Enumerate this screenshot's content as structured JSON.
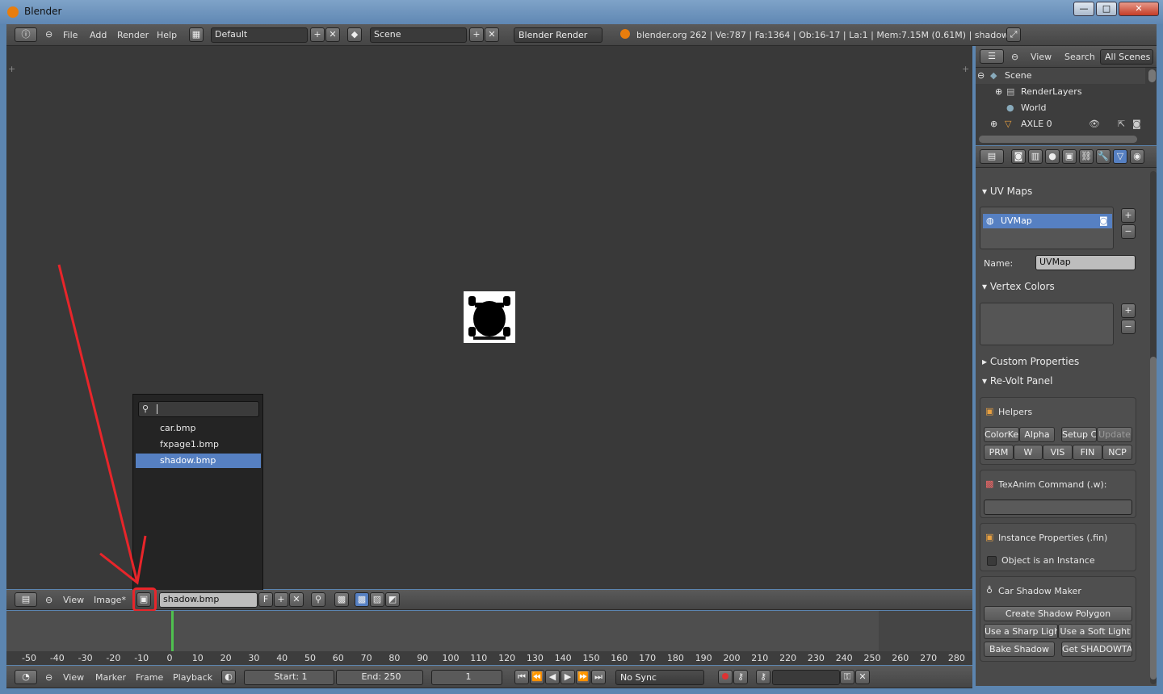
{
  "window": {
    "title": "Blender",
    "minimize": "—",
    "maximize": "□",
    "close": "✕"
  },
  "topbar": {
    "menus": [
      "File",
      "Add",
      "Render",
      "Help"
    ],
    "layout": "Default",
    "scene": "Scene",
    "engine": "Blender Render",
    "info": "blender.org 262 | Ve:787 | Fa:1364 | Ob:16-17 | La:1 | Mem:7.15M (0.61M) | shadow"
  },
  "image_browser": {
    "search_value": "",
    "items": [
      "car.bmp",
      "fxpage1.bmp",
      "shadow.bmp"
    ],
    "selected": "shadow.bmp"
  },
  "image_header": {
    "menus": [
      "View",
      "Image*"
    ],
    "image_name": "shadow.bmp",
    "fake_user": "F"
  },
  "timeline": {
    "ticks": [
      "-50",
      "-40",
      "-30",
      "-20",
      "-10",
      "0",
      "10",
      "20",
      "30",
      "40",
      "50",
      "60",
      "70",
      "80",
      "90",
      "100",
      "110",
      "120",
      "130",
      "140",
      "150",
      "160",
      "170",
      "180",
      "190",
      "200",
      "210",
      "220",
      "230",
      "240",
      "250",
      "260",
      "270",
      "280"
    ],
    "menus": [
      "View",
      "Marker",
      "Frame",
      "Playback"
    ],
    "start": "Start: 1",
    "end": "End: 250",
    "current": "1",
    "sync": "No Sync"
  },
  "outliner": {
    "menus": [
      "View",
      "Search"
    ],
    "filter": "All Scenes",
    "rows": [
      "Scene",
      "RenderLayers",
      "World",
      "AXLE 0"
    ]
  },
  "properties": {
    "uv_maps": {
      "title": "UV Maps",
      "items": [
        "UVMap"
      ],
      "name_label": "Name:",
      "name_value": "UVMap"
    },
    "vertex_colors": {
      "title": "Vertex Colors"
    },
    "custom_properties": {
      "title": "Custom Properties"
    },
    "revolt": {
      "title": "Re-Volt Panel",
      "helpers": {
        "title": "Helpers",
        "row1": [
          "ColorKe",
          "Alpha",
          "Setup C",
          "Update"
        ],
        "row2": [
          "PRM",
          "W",
          "VIS",
          "FIN",
          "NCP"
        ]
      },
      "texanim": {
        "title": "TexAnim Command (.w):",
        "value": ""
      },
      "instance": {
        "title": "Instance Properties (.fin)",
        "checkbox": "Object is an Instance"
      },
      "shadow": {
        "title": "Car Shadow Maker",
        "create": "Create Shadow Polygon",
        "sharp": "Use a Sharp Light",
        "soft": "Use a Soft Light",
        "bake": "Bake Shadow",
        "get": "Get SHADOWTA"
      }
    }
  },
  "colors": {
    "accent": "#5680c2",
    "annotation": "#e8252a",
    "playhead": "#4fc04f"
  }
}
